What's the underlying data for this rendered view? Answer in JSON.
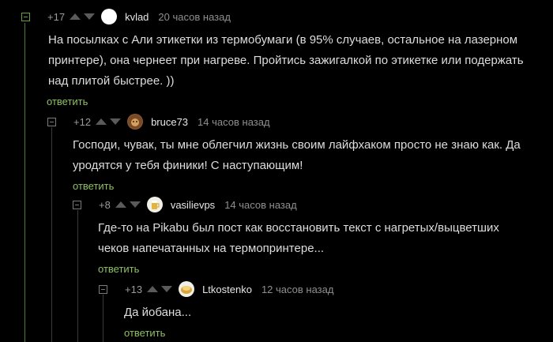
{
  "colors": {
    "background": "#000000",
    "reply_link": "#8dc063",
    "thread_line_root": "#4d7b34",
    "text": "#dddddd",
    "meta": "#8f8f8f"
  },
  "comments": [
    {
      "score": "+17",
      "author": "kvlad",
      "time": "20 часов назад",
      "text": "На посылках с Али этикетки из термобумаги (в 95% случаев, остальное на лазерном принтере), она чернеет при нагреве. Пройтись зажигалкой по этикетке или подержать над плитой быстрее. ))",
      "reply_label": "ответить"
    },
    {
      "score": "+12",
      "author": "bruce73",
      "time": "14 часов назад",
      "text": "Господи, чувак, ты мне облегчил жизнь своим лайфхаком просто не знаю как. Да уродятся у тебя финики! С наступающим!",
      "reply_label": "ответить"
    },
    {
      "score": "+8",
      "author": "vasilievps",
      "time": "14 часов назад",
      "text": "Где-то на Pikabu был пост как восстановить текст с нагретых/выцветших чеков напечатанных на термопринтере...",
      "reply_label": "ответить"
    },
    {
      "score": "+13",
      "author": "Ltkostenko",
      "time": "12 часов назад",
      "text": "Да йобана...",
      "reply_label": "ответить"
    }
  ]
}
